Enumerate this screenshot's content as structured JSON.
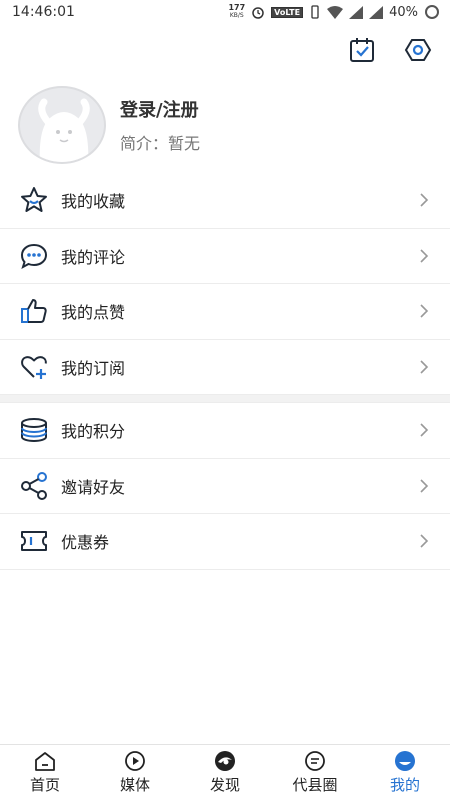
{
  "status_bar": {
    "time": "14:46:01",
    "net_speed": "177",
    "net_unit": "KB/S",
    "volte": "VoLTE",
    "battery": "40%"
  },
  "top_actions": {
    "icons": [
      "calendar-check-icon",
      "settings-icon"
    ]
  },
  "profile": {
    "login_label": "登录/注册",
    "intro": "简介：暂无"
  },
  "menu_group_1": [
    {
      "label": "我的收藏",
      "icon": "star-icon"
    },
    {
      "label": "我的评论",
      "icon": "comment-icon"
    },
    {
      "label": "我的点赞",
      "icon": "thumb-up-icon"
    },
    {
      "label": "我的订阅",
      "icon": "heart-plus-icon"
    }
  ],
  "menu_group_2": [
    {
      "label": "我的积分",
      "icon": "coins-icon"
    },
    {
      "label": "邀请好友",
      "icon": "share-icon"
    },
    {
      "label": "优惠券",
      "icon": "ticket-icon"
    }
  ],
  "bottom_nav": [
    {
      "label": "首页",
      "icon": "home-icon"
    },
    {
      "label": "媒体",
      "icon": "play-icon"
    },
    {
      "label": "发现",
      "icon": "discover-icon"
    },
    {
      "label": "代县圈",
      "icon": "chat-circle-icon"
    },
    {
      "label": "我的",
      "icon": "profile-icon",
      "active": true
    }
  ],
  "colors": {
    "accent": "#2673d1",
    "icon_stroke": "#1f2a38"
  }
}
